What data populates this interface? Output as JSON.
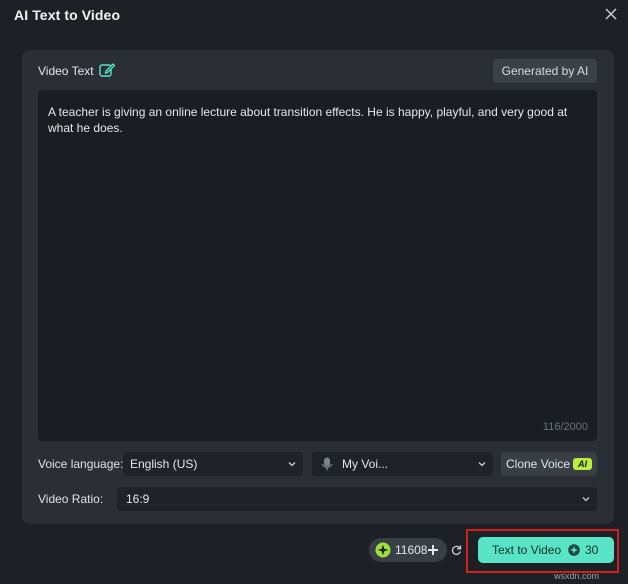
{
  "window": {
    "title": "AI Text to Video"
  },
  "video_text": {
    "label": "Video Text",
    "generated_button": "Generated by AI",
    "content": "A teacher is giving an online lecture about transition effects. He is happy, playful, and very good at what he does.",
    "counter": "116/2000"
  },
  "voice": {
    "language_label": "Voice language:",
    "language_value": "English (US)",
    "voice_value": "My Voi...",
    "clone_label": "Clone Voice",
    "clone_badge": "AI"
  },
  "ratio": {
    "label": "Video Ratio:",
    "value": "16:9"
  },
  "footer": {
    "credits": "11608",
    "action_label": "Text to Video",
    "action_cost": "30",
    "watermark": "wsxdn.com"
  },
  "colors": {
    "accent": "#59e5c5",
    "highlight": "#d41e1e",
    "badge": "#b9ee3a"
  }
}
